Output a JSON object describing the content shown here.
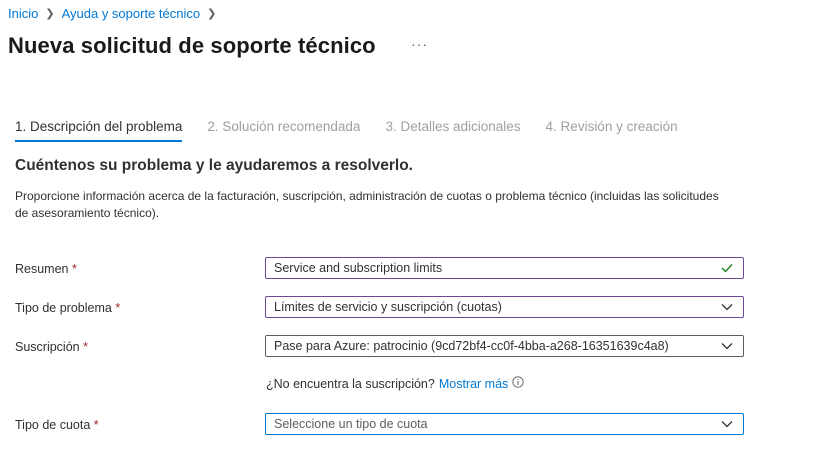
{
  "breadcrumb": {
    "items": [
      "Inicio",
      "Ayuda y soporte técnico"
    ]
  },
  "header": {
    "title": "Nueva solicitud de soporte técnico",
    "more": "···"
  },
  "tabs": [
    {
      "label": "1. Descripción del problema",
      "active": true
    },
    {
      "label": "2. Solución recomendada",
      "active": false
    },
    {
      "label": "3. Detalles adicionales",
      "active": false
    },
    {
      "label": "4. Revisión y creación",
      "active": false
    }
  ],
  "section": {
    "title": "Cuéntenos su problema y le ayudaremos a resolverlo.",
    "description": "Proporcione información acerca de la facturación, suscripción, administración de cuotas o problema técnico (incluidas las solicitudes de asesoramiento técnico)."
  },
  "form": {
    "summary": {
      "label": "Resumen",
      "required": "*",
      "value": "Service and subscription limits"
    },
    "problem_type": {
      "label": "Tipo de problema",
      "required": "*",
      "value": "Límites de servicio y suscripción (cuotas)"
    },
    "subscription": {
      "label": "Suscripción",
      "required": "*",
      "value": "Pase para Azure: patrocinio (9cd72bf4-cc0f-4bba-a268-16351639c4a8)",
      "hint": "¿No encuentra la suscripción?",
      "hint_link": "Mostrar más"
    },
    "quota_type": {
      "label": "Tipo de cuota",
      "required": "*",
      "placeholder": "Seleccione un tipo de cuota"
    }
  },
  "colors": {
    "accent": "#0078d4",
    "required": "#a4262c",
    "valid": "#107c10",
    "purple_border": "#6b4a95"
  }
}
